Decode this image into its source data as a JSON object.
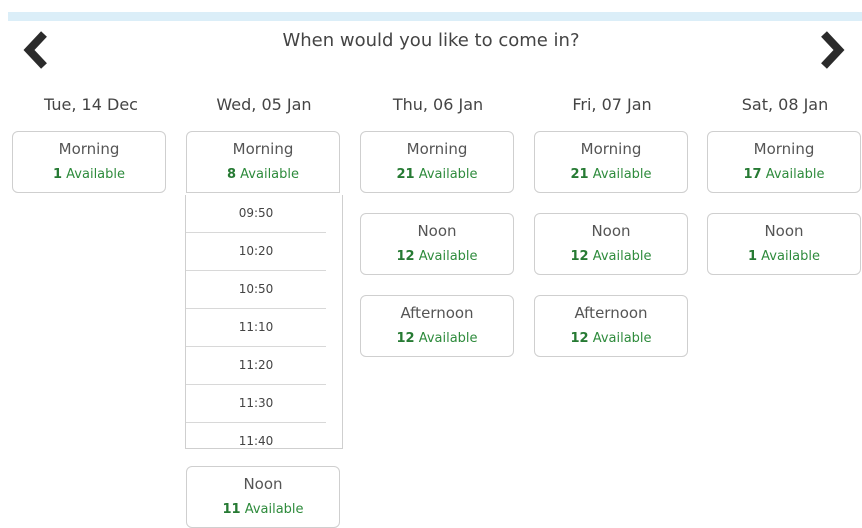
{
  "title": "When would you like to come in?",
  "nav": {
    "prev_icon": "chevron-left-icon",
    "next_icon": "chevron-right-icon"
  },
  "colors": {
    "available_green": "#2e8b3c",
    "topbar": "#dbeef8"
  },
  "days": [
    {
      "label": "Tue, 14 Dec",
      "slots": [
        {
          "name": "Morning",
          "count": "1",
          "suffix": "Available"
        }
      ]
    },
    {
      "label": "Wed, 05 Jan",
      "slots": [
        {
          "name": "Morning",
          "count": "8",
          "suffix": "Available"
        },
        {
          "name": "Noon",
          "count": "11",
          "suffix": "Available"
        }
      ],
      "times": [
        "09:50",
        "10:20",
        "10:50",
        "11:10",
        "11:20",
        "11:30",
        "11:40"
      ]
    },
    {
      "label": "Thu, 06 Jan",
      "slots": [
        {
          "name": "Morning",
          "count": "21",
          "suffix": "Available"
        },
        {
          "name": "Noon",
          "count": "12",
          "suffix": "Available"
        },
        {
          "name": "Afternoon",
          "count": "12",
          "suffix": "Available"
        }
      ]
    },
    {
      "label": "Fri, 07 Jan",
      "slots": [
        {
          "name": "Morning",
          "count": "21",
          "suffix": "Available"
        },
        {
          "name": "Noon",
          "count": "12",
          "suffix": "Available"
        },
        {
          "name": "Afternoon",
          "count": "12",
          "suffix": "Available"
        }
      ]
    },
    {
      "label": "Sat, 08 Jan",
      "slots": [
        {
          "name": "Morning",
          "count": "17",
          "suffix": "Available"
        },
        {
          "name": "Noon",
          "count": "1",
          "suffix": "Available"
        }
      ]
    }
  ]
}
